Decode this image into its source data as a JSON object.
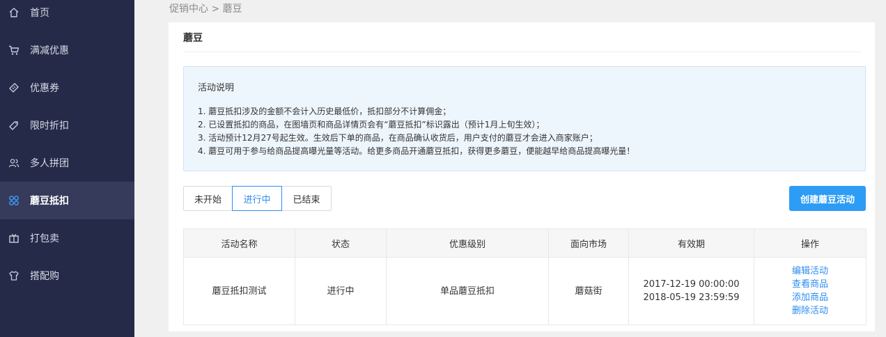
{
  "sidebar": {
    "items": [
      {
        "label": "首页",
        "icon": "home-icon",
        "active": false
      },
      {
        "label": "满减优惠",
        "icon": "cart-icon",
        "active": false
      },
      {
        "label": "优惠券",
        "icon": "coupon-icon",
        "active": false
      },
      {
        "label": "限时折扣",
        "icon": "tag-icon",
        "active": false
      },
      {
        "label": "多人拼团",
        "icon": "group-icon",
        "active": false
      },
      {
        "label": "蘑豆抵扣",
        "icon": "grid-icon",
        "active": true
      },
      {
        "label": "打包卖",
        "icon": "package-icon",
        "active": false
      },
      {
        "label": "搭配购",
        "icon": "shirt-icon",
        "active": false
      }
    ]
  },
  "breadcrumb": "促销中心 > 蘑豆",
  "card": {
    "title": "蘑豆"
  },
  "notice": {
    "title": "活动说明",
    "items": [
      "1. 蘑豆抵扣涉及的金额不会计入历史最低价，抵扣部分不计算佣金；",
      "2. 已设置抵扣的商品，在图墙页和商品详情页会有“蘑豆抵扣”标识露出（预计1月上旬生效）；",
      "3. 活动预计12月27号起生效。生效后下单的商品，在商品确认收货后，用户支付的蘑豆才会进入商家账户；",
      "4. 蘑豆可用于参与给商品提高曝光量等活动。给更多商品开通蘑豆抵扣，获得更多蘑豆，便能越早给商品提高曝光量！"
    ]
  },
  "tabs": [
    {
      "label": "未开始",
      "active": false
    },
    {
      "label": "进行中",
      "active": true
    },
    {
      "label": "已结束",
      "active": false
    }
  ],
  "create_button": "创建蘑豆活动",
  "table": {
    "headers": [
      "活动名称",
      "状态",
      "优惠级别",
      "面向市场",
      "有效期",
      "操作"
    ],
    "rows": [
      {
        "name": "蘑豆抵扣测试",
        "status": "进行中",
        "level": "单品蘑豆抵扣",
        "market": "蘑菇街",
        "period_start": "2017-12-19 00:00:00",
        "period_end": "2018-05-19 23:59:59",
        "actions": [
          "编辑活动",
          "查看商品",
          "添加商品",
          "删除活动"
        ]
      }
    ]
  },
  "colors": {
    "sidebar_bg": "#252a48",
    "sidebar_active_bg": "#363b5b",
    "accent": "#2d8cf0",
    "button_bg": "#2d9cf5",
    "notice_bg": "#eef6fd"
  }
}
